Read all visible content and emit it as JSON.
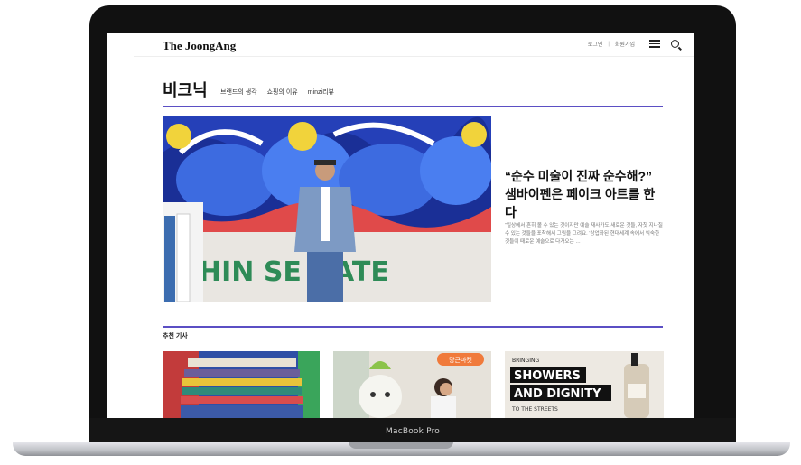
{
  "site": {
    "logo": "The JoongAng",
    "login": "로그인",
    "signup": "회원가입"
  },
  "section": {
    "title": "비크닉",
    "tabs": [
      "브랜드의 생각",
      "쇼핑의 이유",
      "minzi리뷰"
    ]
  },
  "hero": {
    "title": "“순수 미술이 진짜 순수해?” 샘바이펜은 페이크 아트를 한다",
    "description": "“일상에서 흔히 볼 수 있는 것이자만 예술 재사가도 새로운 것들, 자칫 지나칠 수 있는 것들을 포착해서 그림을 그려요. ‘상업화된 현대세계 속에서 익숙한 것들이 때로운 예술으로 다가오는 …",
    "graffiti": "HIN SE GATE"
  },
  "recommended": {
    "title": "추천 기사",
    "card2_badge": "당근마켓",
    "card3_line1": "BRINGING",
    "card3_line2": "SHOWERS",
    "card3_line3": "AND DIGNITY",
    "card3_line4": "TO THE STREETS"
  },
  "device": {
    "model": "MacBook Pro"
  },
  "colors": {
    "accent": "#5b4fc4",
    "laptop_bezel": "#111111"
  }
}
